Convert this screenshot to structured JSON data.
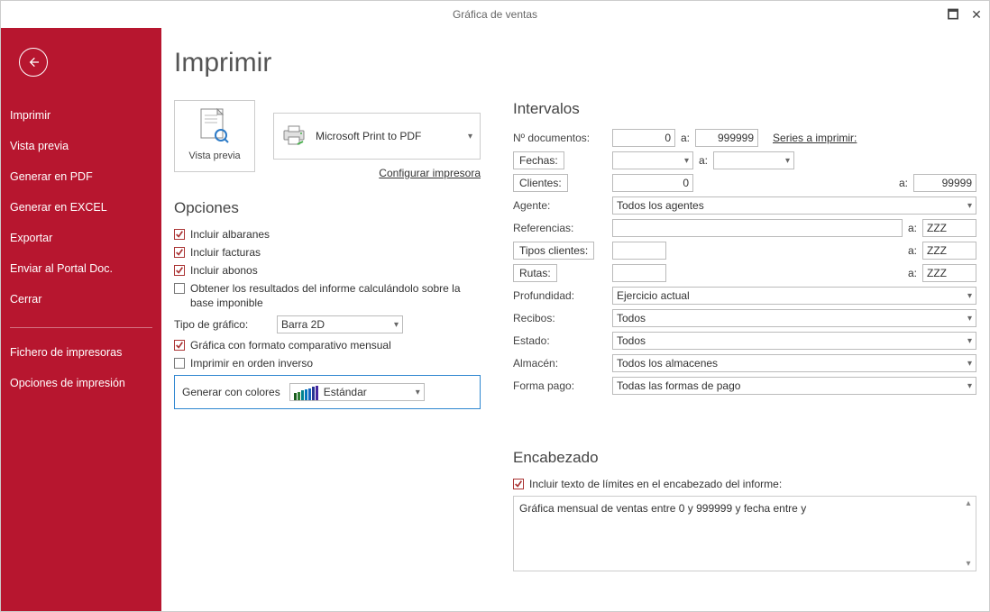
{
  "window": {
    "title": "Gráfica de ventas"
  },
  "sidebar": {
    "items": [
      "Imprimir",
      "Vista previa",
      "Generar en PDF",
      "Generar en EXCEL",
      "Exportar",
      "Enviar al Portal Doc.",
      "Cerrar"
    ],
    "items2": [
      "Fichero de impresoras",
      "Opciones de impresión"
    ]
  },
  "page": {
    "title": "Imprimir",
    "preview_label": "Vista previa",
    "printer_name": "Microsoft Print to PDF",
    "config_link": "Configurar impresora"
  },
  "options": {
    "title": "Opciones",
    "include_albaranes": "Incluir albaranes",
    "include_facturas": "Incluir facturas",
    "include_abonos": "Incluir abonos",
    "obtener_resultados": "Obtener los resultados del informe calculándolo sobre la base imponible",
    "tipo_grafico_label": "Tipo de gráfico:",
    "tipo_grafico_value": "Barra 2D",
    "grafica_comparativo": "Gráfica con formato comparativo mensual",
    "imprimir_inverso": "Imprimir en orden inverso",
    "generar_colores_label": "Generar con colores",
    "generar_colores_value": "Estándar"
  },
  "intervals": {
    "title": "Intervalos",
    "a": "a:",
    "num_doc_label": "Nº documentos:",
    "num_doc_from": "0",
    "num_doc_to": "999999",
    "series_link": "Series a imprimir:",
    "fechas_label": "Fechas:",
    "clientes_label": "Clientes:",
    "clientes_from": "0",
    "clientes_to": "99999",
    "agente_label": "Agente:",
    "agente_value": "Todos los agentes",
    "referencias_label": "Referencias:",
    "referencias_to": "ZZZ",
    "tipos_clientes_label": "Tipos clientes:",
    "tipos_clientes_to": "ZZZ",
    "rutas_label": "Rutas:",
    "rutas_to": "ZZZ",
    "profundidad_label": "Profundidad:",
    "profundidad_value": "Ejercicio actual",
    "recibos_label": "Recibos:",
    "recibos_value": "Todos",
    "estado_label": "Estado:",
    "estado_value": "Todos",
    "almacen_label": "Almacén:",
    "almacen_value": "Todos los almacenes",
    "formapago_label": "Forma pago:",
    "formapago_value": "Todas las formas de pago"
  },
  "header_section": {
    "title": "Encabezado",
    "include_limits": "Incluir texto de límites en el encabezado del informe:",
    "text": "Gráfica mensual de ventas entre 0 y 999999 y fecha entre  y"
  },
  "colors": {
    "bars": [
      "#1b5e20",
      "#2e7d32",
      "#00838f",
      "#0277bd",
      "#1565c0",
      "#283593",
      "#4527a0"
    ]
  }
}
